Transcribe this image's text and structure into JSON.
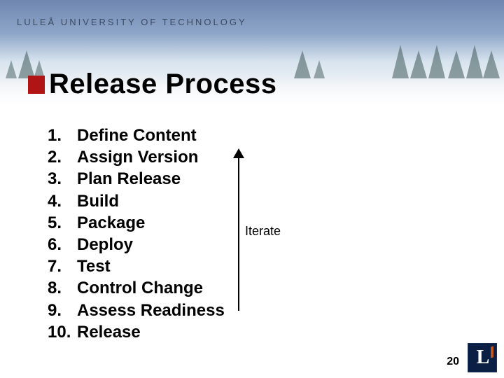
{
  "university_name": "LULEÅ UNIVERSITY OF TECHNOLOGY",
  "title": "Release Process",
  "steps": [
    {
      "n": "1.",
      "text": "Define Content"
    },
    {
      "n": "2.",
      "text": "Assign Version"
    },
    {
      "n": "3.",
      "text": "Plan Release"
    },
    {
      "n": "4.",
      "text": "Build"
    },
    {
      "n": "5.",
      "text": "Package"
    },
    {
      "n": "6.",
      "text": "Deploy"
    },
    {
      "n": "7.",
      "text": "Test"
    },
    {
      "n": "8.",
      "text": "Control Change"
    },
    {
      "n": "9.",
      "text": "Assess Readiness"
    },
    {
      "n": "10.",
      "text": "Release"
    }
  ],
  "iterate_label": "Iterate",
  "page_number": "20",
  "logo_letter": "L"
}
